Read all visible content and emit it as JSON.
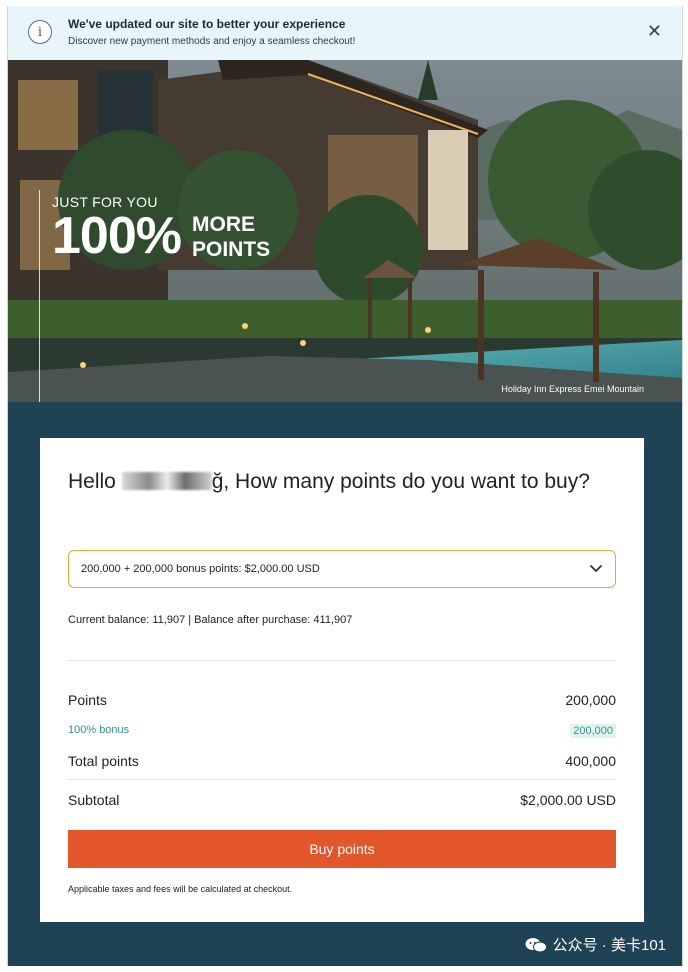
{
  "notice": {
    "title": "We've updated our site to better your experience",
    "subtitle": "Discover new payment methods and enjoy a seamless checkout!",
    "close_glyph": "✕",
    "info_glyph": "i"
  },
  "hero": {
    "kicker": "JUST FOR YOU",
    "headline": "100%",
    "headline_suffix_1": "MORE",
    "headline_suffix_2": "POINTS",
    "caption": "Holiday Inn Express Emei Mountain"
  },
  "purchase": {
    "greeting_prefix": "Hello",
    "greeting_suffix": "ğ, How many points do you want to buy?",
    "selected_option": "200,000 + 200,000 bonus points: $2,000.00 USD",
    "balance_line": "Current balance: 11,907  |  Balance after purchase: 411,907",
    "rows": {
      "points_label": "Points",
      "points_value": "200,000",
      "bonus_label": "100% bonus",
      "bonus_value": "200,000",
      "total_label": "Total points",
      "total_value": "400,000",
      "subtotal_label": "Subtotal",
      "subtotal_value": "$2,000.00 USD"
    },
    "buy_label": "Buy points",
    "note": "Applicable taxes and fees will be calculated at checkout."
  },
  "watermark": {
    "text": "公众号 · 美卡101"
  },
  "colors": {
    "accent": "#e3552a",
    "page_bg": "#1f4355",
    "select_border": "#e3a53f",
    "bonus_text": "#3b8f8c",
    "notice_bg": "#e8f6fb"
  },
  "icons": [
    "info-icon",
    "close-icon",
    "chevron-down-icon",
    "wechat-icon"
  ]
}
